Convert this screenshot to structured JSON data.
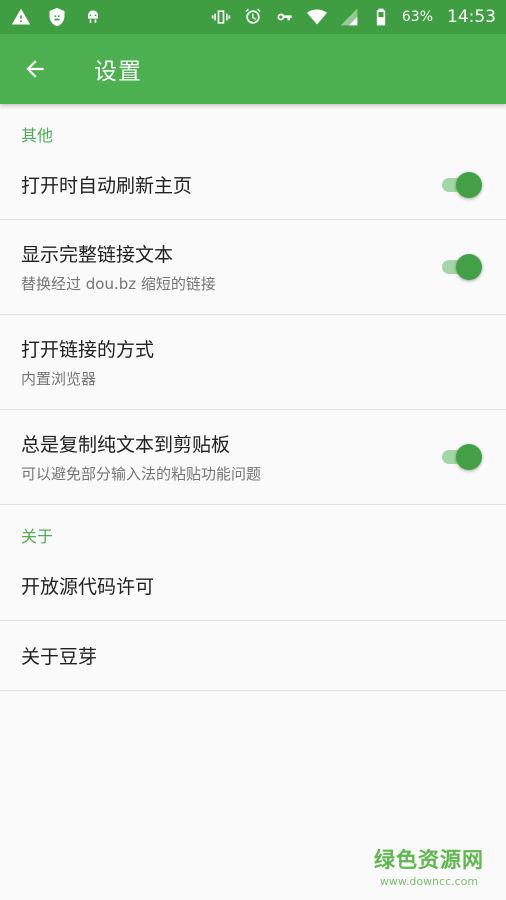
{
  "status_bar": {
    "battery_percent": "63%",
    "time": "14:53",
    "icons_left": [
      "warning-icon",
      "shield-icon",
      "android-icon"
    ],
    "icons_right": [
      "vibrate-icon",
      "alarm-icon",
      "key-icon",
      "wifi-icon",
      "signal-icon",
      "battery-icon"
    ]
  },
  "app_bar": {
    "title": "设置",
    "back_icon": "arrow-back-icon",
    "color": "#4caf50"
  },
  "sections": [
    {
      "header": "其他",
      "items": [
        {
          "title": "打开时自动刷新主页",
          "summary": "",
          "toggle": true
        },
        {
          "title": "显示完整链接文本",
          "summary": "替换经过 dou.bz 缩短的链接",
          "toggle": true
        },
        {
          "title": "打开链接的方式",
          "summary": "内置浏览器",
          "toggle": null
        },
        {
          "title": "总是复制纯文本到剪贴板",
          "summary": "可以避免部分输入法的粘贴功能问题",
          "toggle": true
        }
      ]
    },
    {
      "header": "关于",
      "items": [
        {
          "title": "开放源代码许可",
          "summary": ""
        },
        {
          "title": "关于豆芽",
          "summary": ""
        }
      ]
    }
  ],
  "watermark": {
    "main": "绿色资源网",
    "sub": "www.downcc.com"
  },
  "colors": {
    "accent": "#4caf50",
    "status_bar": "#3f9e42",
    "toggle_thumb": "#43a047",
    "toggle_track": "#a5d6a7"
  }
}
